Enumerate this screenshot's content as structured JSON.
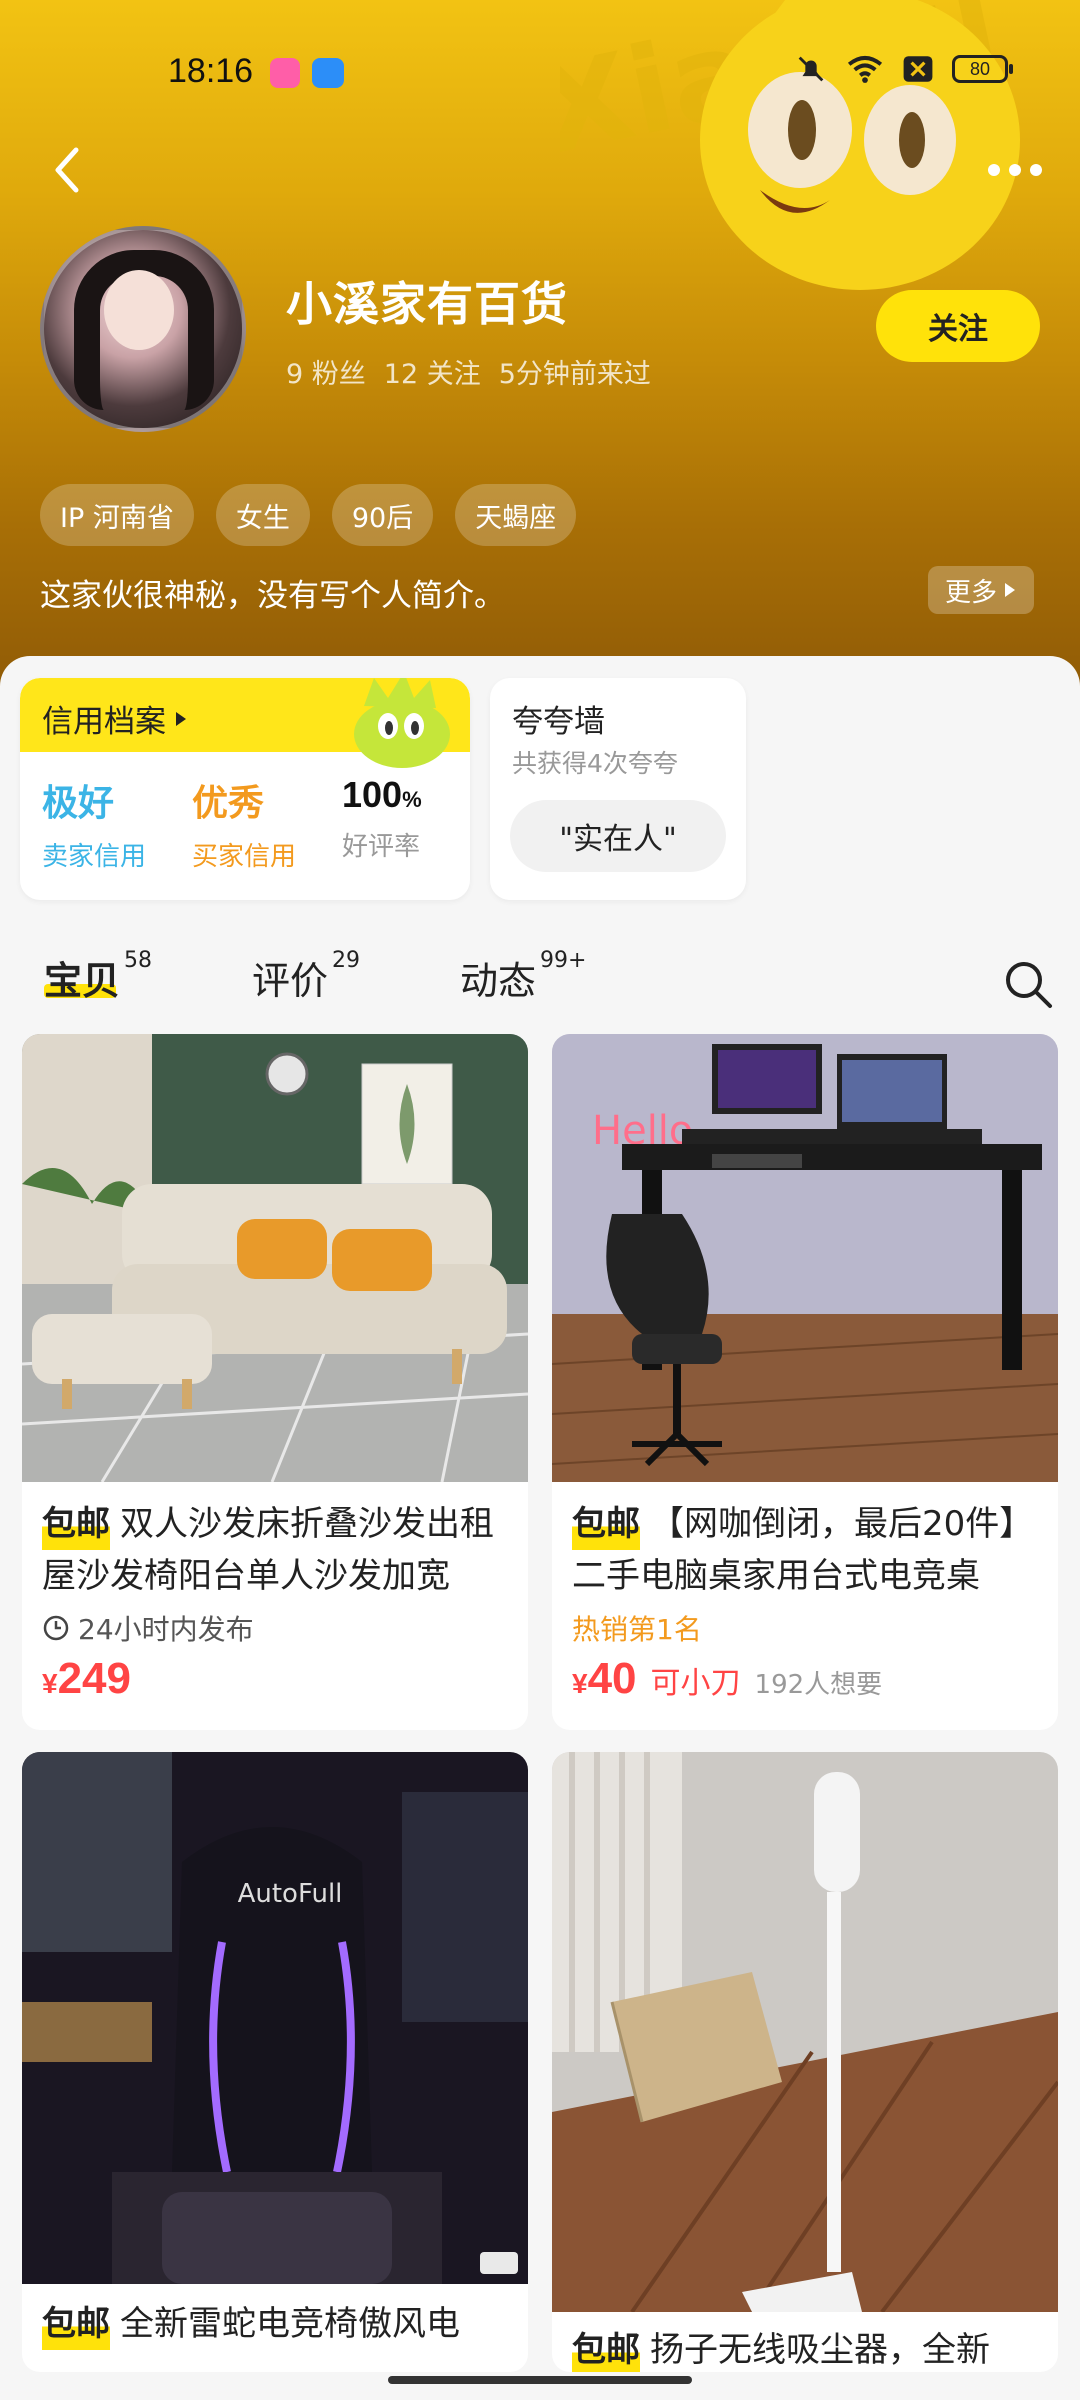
{
  "status_bar": {
    "time": "18:16",
    "battery": "80"
  },
  "profile": {
    "name": "小溪家有百货",
    "fans": "9 粉丝",
    "following": "12 关注",
    "last_seen": "5分钟前来过",
    "follow_label": "关注",
    "tags": [
      "IP 河南省",
      "女生",
      "90后",
      "天蝎座"
    ],
    "bio": "这家伙很神秘，没有写个人简介。",
    "more_label": "更多"
  },
  "credit": {
    "title": "信用档案",
    "seller_value": "极好",
    "seller_label": "卖家信用",
    "buyer_value": "优秀",
    "buyer_label": "买家信用",
    "rate_value": "100",
    "rate_unit": "%",
    "rate_label": "好评率"
  },
  "praise": {
    "title": "夸夸墙",
    "subtitle": "共获得4次夸夸",
    "pill": "\"实在人\""
  },
  "tabs": [
    {
      "label": "宝贝",
      "count": "58"
    },
    {
      "label": "评价",
      "count": "29"
    },
    {
      "label": "动态",
      "count": "99+"
    }
  ],
  "products": [
    {
      "badge": "包邮",
      "title": "双人沙发床折叠沙发出租屋沙发椅阳台单人沙发加宽",
      "meta": "24小时内发布",
      "price": "249",
      "currency": "¥"
    },
    {
      "badge": "包邮",
      "title": "【网咖倒闭，最后20件】二手电脑桌家用台式电竞桌",
      "meta": "热销第1名",
      "price": "40",
      "currency": "¥",
      "bargain": "可小刀",
      "wants": "192人想要"
    },
    {
      "badge": "包邮",
      "title": "全新雷蛇电竞椅傲风电",
      "chair_brand": "AutoFull"
    },
    {
      "badge": "包邮",
      "title": "扬子无线吸尘器，全新"
    }
  ],
  "colors": {
    "accent_yellow": "#ffe20a",
    "price_red": "#ff4444",
    "seller_blue": "#3bb4e6",
    "buyer_orange": "#f39a1e",
    "hot_orange": "#f39a1e"
  }
}
